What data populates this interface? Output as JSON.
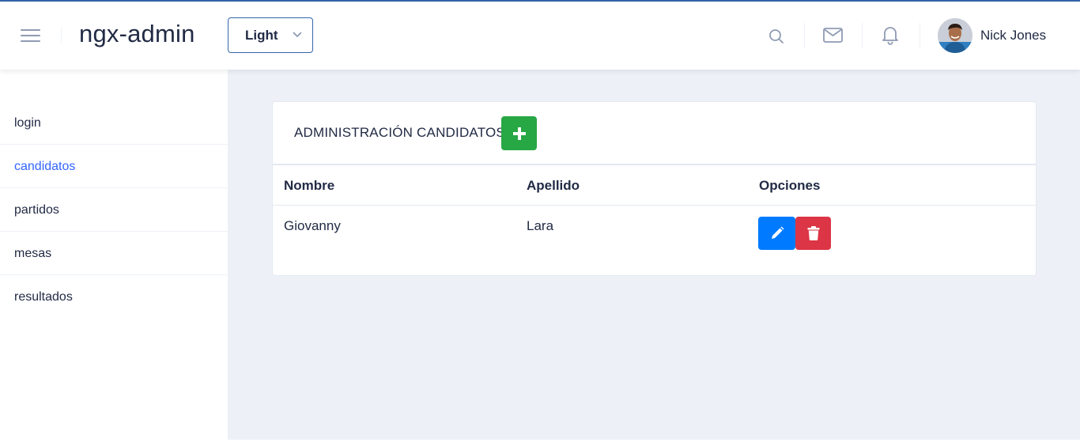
{
  "header": {
    "logo": "ngx-admin",
    "theme_select": {
      "value": "Light"
    },
    "user": {
      "name": "Nick Jones"
    },
    "icons": [
      "menu-icon",
      "search-icon",
      "email-icon",
      "bell-icon"
    ]
  },
  "sidebar": {
    "items": [
      {
        "label": "login",
        "active": false
      },
      {
        "label": "candidatos",
        "active": true
      },
      {
        "label": "partidos",
        "active": false
      },
      {
        "label": "mesas",
        "active": false
      },
      {
        "label": "resultados",
        "active": false
      }
    ]
  },
  "card": {
    "title": "ADMINISTRACIÓN CANDIDATOS",
    "table": {
      "headers": [
        "Nombre",
        "Apellido",
        "Opciones"
      ],
      "rows": [
        {
          "nombre": "Giovanny",
          "apellido": "Lara"
        }
      ]
    }
  },
  "colors": {
    "accent": "#3366ff",
    "add": "#28a745",
    "edit": "#007bff",
    "delete": "#dc3545",
    "background": "#edf1f7"
  }
}
